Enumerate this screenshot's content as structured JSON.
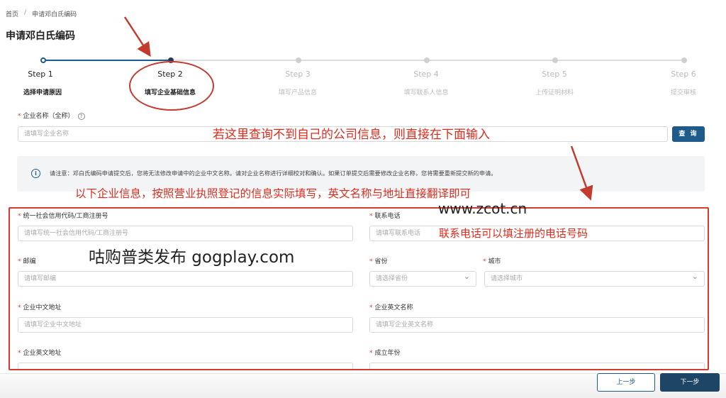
{
  "breadcrumb": {
    "home": "首页",
    "separator": "/",
    "current": "申请邓白氏编码"
  },
  "page_title": "申请邓白氏编码",
  "steps": [
    {
      "title": "Step 1",
      "desc": "选择申请原因"
    },
    {
      "title": "Step 2",
      "desc": "填写企业基础信息"
    },
    {
      "title": "Step 3",
      "desc": "填写产品信息"
    },
    {
      "title": "Step 4",
      "desc": "填写联系人信息"
    },
    {
      "title": "Step 5",
      "desc": "上传证明材料"
    },
    {
      "title": "Step 6",
      "desc": "提交审核"
    }
  ],
  "company_name": {
    "label": "企业名称（全称）",
    "placeholder": "请填写企业名称",
    "help_icon": "?"
  },
  "search_button": "查 询",
  "notice": {
    "icon": "i",
    "text": "请注意：邓白氏编码申请提交后，您将无法修改申请中的企业中文名称。请对企业名称进行详细校对和确认。如果订单提交后需要修改企业名称，您将需要重新提交新的申请。"
  },
  "fields": {
    "credit_code": {
      "label": "统一社会信用代码/工商注册号",
      "placeholder": "请填写统一社会信用代码/工商注册号"
    },
    "phone": {
      "label": "联系电话",
      "placeholder": "请填写联系电话"
    },
    "postcode": {
      "label": "邮编",
      "placeholder": "请填写邮编"
    },
    "province": {
      "label": "省份",
      "placeholder": "请选择省份"
    },
    "city": {
      "label": "城市",
      "placeholder": "请选择城市"
    },
    "address_cn": {
      "label": "企业中文地址",
      "placeholder": "请填写企业中文地址"
    },
    "name_en": {
      "label": "企业英文名称",
      "placeholder": "请填写企业英文名称"
    },
    "address_en": {
      "label": "企业英文地址"
    },
    "founded_year": {
      "label": "成立年份"
    }
  },
  "annotations": {
    "search_hint": "若这里查询不到自己的公司信息，则直接在下面输入",
    "fill_hint": "以下企业信息，按照营业执照登记的信息实际填写，英文名称与地址直接翻译即可",
    "phone_hint": "联系电话可以填注册的电话号码"
  },
  "watermarks": {
    "site": "www.zcot.cn",
    "publisher": "咕购普类发布 gogplay.com"
  },
  "buttons": {
    "prev": "上一步",
    "next": "下一步"
  },
  "colors": {
    "primary": "#1e5b8a",
    "annotation_red": "#e02a1c"
  }
}
